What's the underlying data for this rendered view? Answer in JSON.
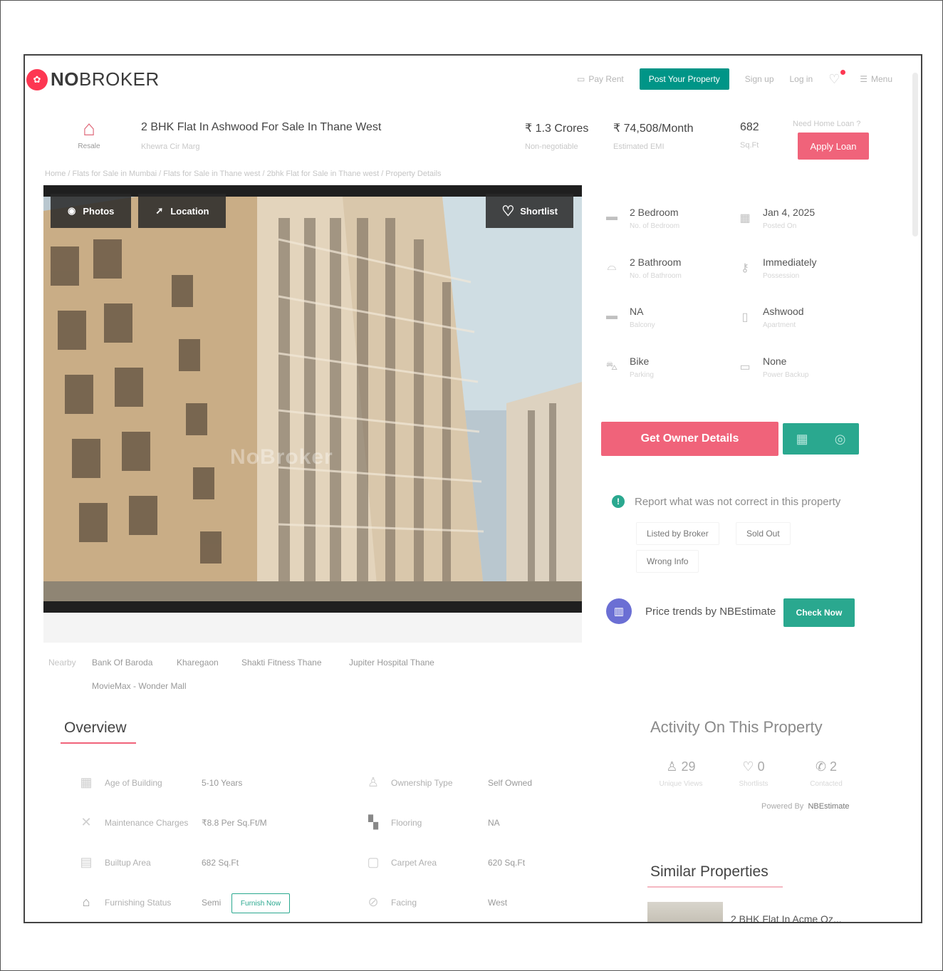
{
  "header": {
    "logo_prefix": "NO",
    "logo_suffix": "BROKER",
    "pay_rent": "Pay Rent",
    "post_property": "Post Your Property",
    "sign_up": "Sign up",
    "log_in": "Log in",
    "menu": "Menu"
  },
  "listing": {
    "badge_label": "Resale",
    "title": "2 BHK Flat In Ashwood For Sale In Thane West",
    "address": "Khewra Cir Marg",
    "price": "₹ 1.3 Crores",
    "price_note": "Non-negotiable",
    "emi": "₹ 74,508/Month",
    "emi_label": "Estimated EMI",
    "area": "682",
    "area_unit": "Sq.Ft",
    "loan_prompt": "Need Home Loan ?",
    "apply_loan": "Apply Loan",
    "breadcrumb": "Home / Flats for Sale in Mumbai / Flats for Sale in Thane west / 2bhk Flat for Sale in Thane west / Property Details"
  },
  "photo": {
    "photos_btn": "Photos",
    "location_btn": "Location",
    "shortlist_btn": "Shortlist",
    "watermark": "NoBroker"
  },
  "attributes": [
    {
      "value": "2 Bedroom",
      "label": "No. of Bedroom",
      "icon": "bed-icon"
    },
    {
      "value": "Jan 4, 2025",
      "label": "Posted On",
      "icon": "calendar-icon"
    },
    {
      "value": "2 Bathroom",
      "label": "No. of Bathroom",
      "icon": "bath-icon"
    },
    {
      "value": "Immediately",
      "label": "Possession",
      "icon": "key-icon"
    },
    {
      "value": "NA",
      "label": "Balcony",
      "icon": "balcony-icon"
    },
    {
      "value": "Ashwood",
      "label": "Apartment",
      "icon": "building-icon"
    },
    {
      "value": "Bike",
      "label": "Parking",
      "icon": "car-icon"
    },
    {
      "value": "None",
      "label": "Power Backup",
      "icon": "battery-icon"
    }
  ],
  "actions": {
    "owner_details": "Get Owner Details",
    "report_text": "Report what was not correct in this property",
    "chips": [
      "Listed by Broker",
      "Sold Out",
      "Wrong Info"
    ],
    "nbe_text": "Price trends by NBEstimate",
    "check_now": "Check Now"
  },
  "nearby": {
    "label": "Nearby",
    "places": [
      "Bank Of Baroda",
      "Kharegaon",
      "Shakti Fitness Thane",
      "Jupiter Hospital Thane",
      "MovieMax - Wonder Mall"
    ]
  },
  "overview": {
    "title": "Overview",
    "rows": [
      {
        "label": "Age of Building",
        "value": "5-10 Years"
      },
      {
        "label": "Ownership Type",
        "value": "Self Owned"
      },
      {
        "label": "Maintenance Charges",
        "value": "₹8.8 Per Sq.Ft/M"
      },
      {
        "label": "Flooring",
        "value": "NA"
      },
      {
        "label": "Builtup Area",
        "value": "682 Sq.Ft"
      },
      {
        "label": "Carpet Area",
        "value": "620 Sq.Ft"
      },
      {
        "label": "Furnishing Status",
        "value": "Semi"
      },
      {
        "label": "Facing",
        "value": "West"
      }
    ],
    "furnish_now": "Furnish Now"
  },
  "activity": {
    "title": "Activity On This Property",
    "stats": [
      {
        "value": "29",
        "label": "Unique Views"
      },
      {
        "value": "0",
        "label": "Shortlists"
      },
      {
        "value": "2",
        "label": "Contacted"
      }
    ],
    "powered_by": "Powered By",
    "powered_brand": "NBEstimate"
  },
  "similar": {
    "title": "Similar Properties",
    "first_name": "2 BHK Flat In Acme Oz..."
  },
  "colors": {
    "brand_pink": "#f0637a",
    "brand_green": "#2aa88f",
    "nbe_purple": "#6b6fd4"
  }
}
